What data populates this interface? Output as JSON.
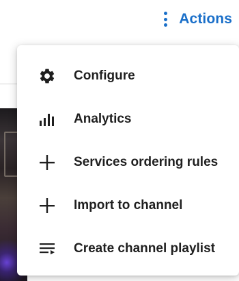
{
  "header": {
    "actions_label": "Actions",
    "actions_icon": "kebab-vertical-icon"
  },
  "menu": {
    "items": [
      {
        "label": "Configure",
        "icon": "gear-icon"
      },
      {
        "label": "Analytics",
        "icon": "bar-chart-icon"
      },
      {
        "label": "Services ordering rules",
        "icon": "plus-icon"
      },
      {
        "label": "Import to channel",
        "icon": "plus-icon"
      },
      {
        "label": "Create channel playlist",
        "icon": "playlist-add-icon"
      }
    ]
  },
  "colors": {
    "accent": "#1a6fc9",
    "menu_text": "#1f1f1f",
    "menu_background": "#ffffff"
  }
}
